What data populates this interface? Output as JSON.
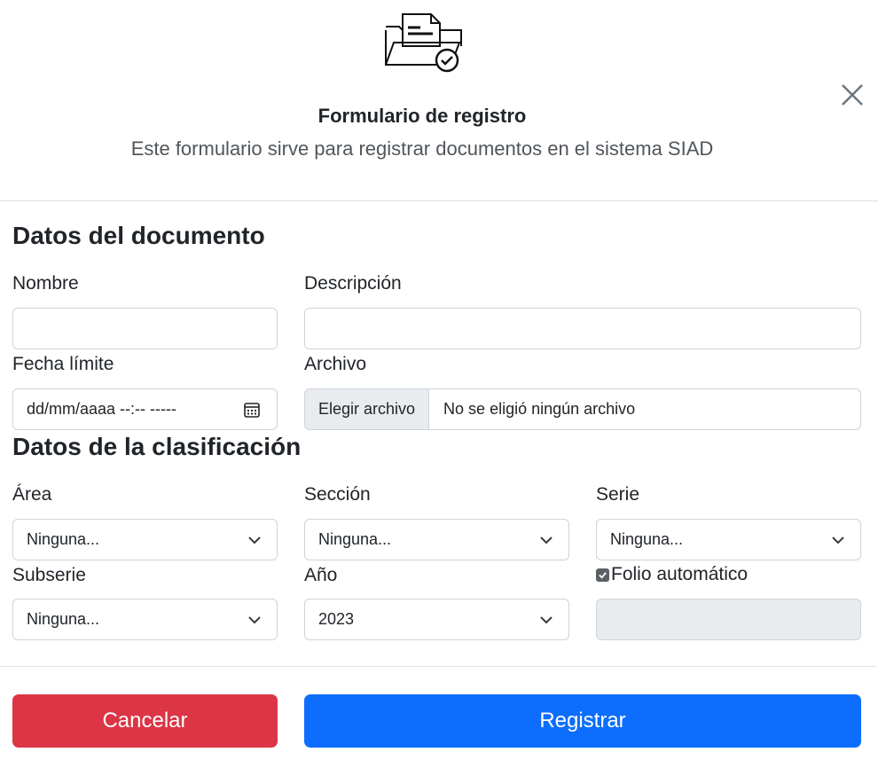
{
  "header": {
    "title": "Formulario de registro",
    "subtitle": "Este formulario sirve para registrar documentos en el sistema SIAD",
    "icon": "document-folder-check-icon",
    "close_icon": "close-icon"
  },
  "document_section": {
    "title": "Datos del documento",
    "nombre_label": "Nombre",
    "nombre_value": "",
    "descripcion_label": "Descripción",
    "descripcion_value": "",
    "fecha_label": "Fecha límite",
    "fecha_placeholder": "dd/mm/aaaa --:-- -----",
    "archivo_label": "Archivo",
    "archivo_button": "Elegir archivo",
    "archivo_status": "No se eligió ningún archivo"
  },
  "classification_section": {
    "title": "Datos de la clasificación",
    "area_label": "Área",
    "area_value": "Ninguna...",
    "seccion_label": "Sección",
    "seccion_value": "Ninguna...",
    "serie_label": "Serie",
    "serie_value": "Ninguna...",
    "subserie_label": "Subserie",
    "subserie_value": "Ninguna...",
    "anio_label": "Año",
    "anio_value": "2023",
    "folio_label": "Folio automático",
    "folio_checked": true,
    "folio_value": ""
  },
  "footer": {
    "cancel_label": "Cancelar",
    "submit_label": "Registrar"
  },
  "colors": {
    "cancel": "#dc3545",
    "submit": "#0d6efd",
    "disabled_field": "#e9ecef",
    "border": "#ced4da"
  }
}
